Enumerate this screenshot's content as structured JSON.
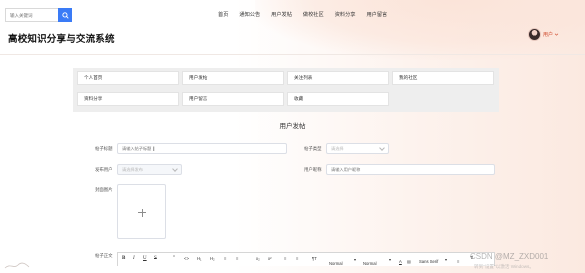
{
  "search": {
    "placeholder": "输入关键词"
  },
  "nav": [
    "首页",
    "通知公告",
    "用户发帖",
    "做校社区",
    "资料分享",
    "用户留言"
  ],
  "site_title": "高校知识分享与交流系统",
  "user": {
    "name": "用户"
  },
  "menu": [
    "个人首页",
    "用户发帖",
    "关注列表",
    "我的社区",
    "资料分享",
    "用户留言",
    "收藏"
  ],
  "form": {
    "title": "用户发帖",
    "post_title": {
      "label": "帖子标题",
      "placeholder": "请输入帖子标题"
    },
    "post_type": {
      "label": "帖子类型",
      "placeholder": "请选择"
    },
    "publisher": {
      "label": "发布用户",
      "placeholder": "请选择发布"
    },
    "user_name": {
      "label": "用户昵称",
      "placeholder": "请输入用户昵称"
    },
    "cover": {
      "label": "封面图片"
    },
    "content": {
      "label": "帖子正文"
    }
  },
  "toolbar": [
    "B",
    "I",
    "U",
    "S",
    "”",
    "<>",
    "H₁",
    "H₂",
    "≡",
    "≡",
    "x₂",
    "x²",
    "≡",
    "≡",
    "¶T",
    "Normal",
    "▾",
    "Normal",
    "▾",
    "A",
    "▤",
    "Sans Serif",
    "▾",
    "≡",
    "T̸"
  ],
  "watermark": "CSDN @MZ_ZXD001",
  "activate": "转到\"设置\"以激活 Windows。",
  "colors": {
    "accent": "#3a7bf6",
    "user_name": "#d04b2e",
    "panel": "#eeeeee"
  }
}
